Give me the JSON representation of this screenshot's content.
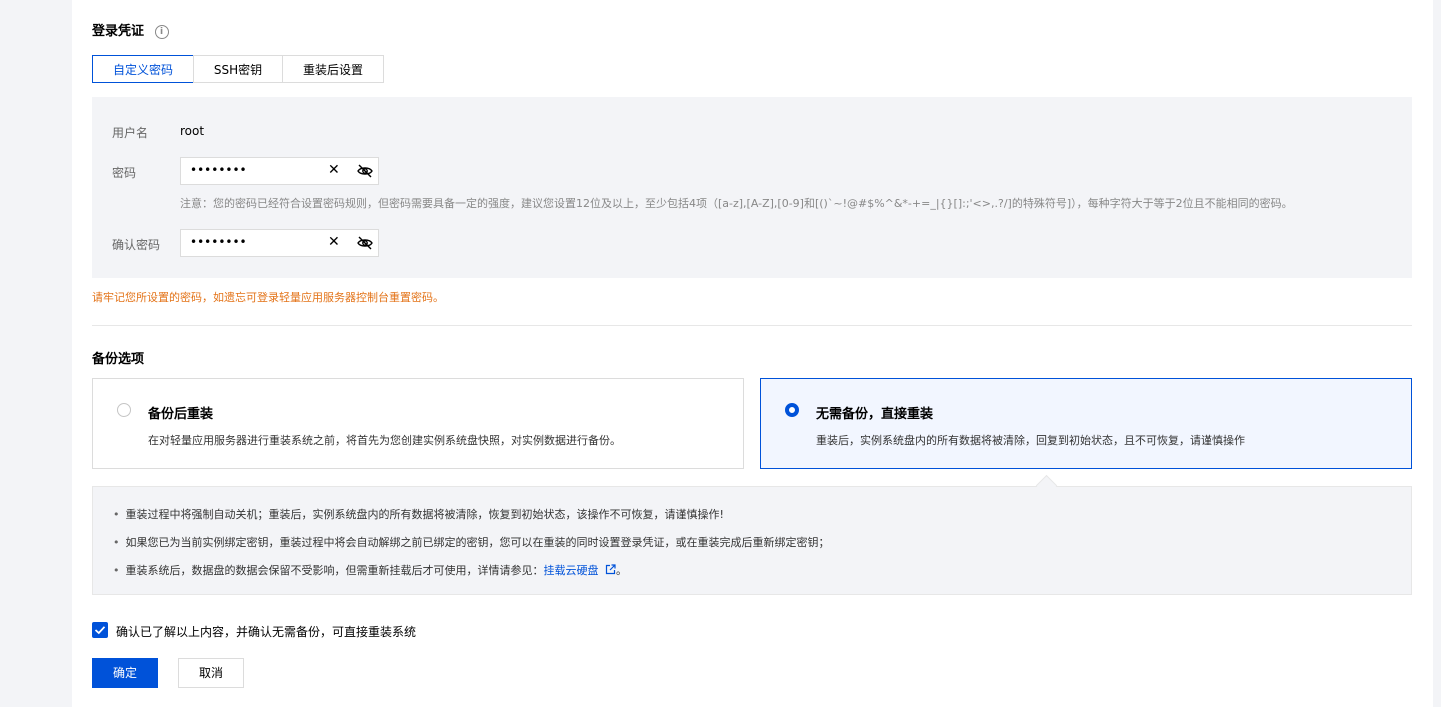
{
  "credentials": {
    "title": "登录凭证",
    "info_icon": "i",
    "tabs": [
      "自定义密码",
      "SSH密钥",
      "重装后设置"
    ],
    "username_label": "用户名",
    "username_value": "root",
    "password_label": "密码",
    "password_mask": "••••••••",
    "password_hint": "注意：您的密码已经符合设置密码规则，但密码需要具备一定的强度，建议您设置12位及以上，至少包括4项（[a-z],[A-Z],[0-9]和[()`~!@#$%^&*-+=_|{}[]:;'<>,.?/]的特殊符号]），每种字符大于等于2位且不能相同的密码。",
    "confirm_label": "确认密码",
    "confirm_mask": "••••••••",
    "clear_glyph": "✕",
    "warning": "请牢记您所设置的密码，如遗忘可登录轻量应用服务器控制台重置密码。"
  },
  "backup": {
    "title": "备份选项",
    "options": [
      {
        "title": "备份后重装",
        "desc": "在对轻量应用服务器进行重装系统之前，将首先为您创建实例系统盘快照，对实例数据进行备份。"
      },
      {
        "title": "无需备份，直接重装",
        "desc": "重装后，实例系统盘内的所有数据将被清除，回复到初始状态，且不可恢复，请谨慎操作"
      }
    ],
    "selected": 1
  },
  "notice": {
    "bullet": "•",
    "items": [
      "重装过程中将强制自动关机；重装后，实例系统盘内的所有数据将被清除，恢复到初始状态，该操作不可恢复，请谨慎操作!",
      "如果您已为当前实例绑定密钥，重装过程中将会自动解绑之前已绑定的密钥，您可以在重装的同时设置登录凭证，或在重装完成后重新绑定密钥；",
      "重装系统后，数据盘的数据会保留不受影响，但需重新挂载后才可使用，详情请参见："
    ],
    "link_text": "挂载云硬盘",
    "link_suffix": "。"
  },
  "confirm_checkbox": {
    "label": "确认已了解以上内容，并确认无需备份，可直接重装系统",
    "checked": true
  },
  "buttons": {
    "ok": "确定",
    "cancel": "取消"
  },
  "colors": {
    "brand": "#0052d9",
    "warning": "#e37318",
    "background": "#f3f4f7"
  }
}
